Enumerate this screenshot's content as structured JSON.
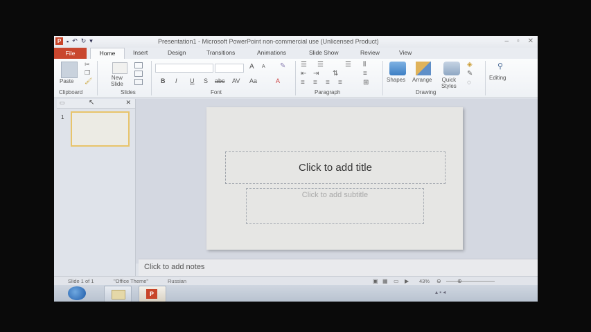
{
  "window": {
    "title": "Presentation1 - Microsoft PowerPoint non-commercial use (Unlicensed Product)",
    "app_icon": "P"
  },
  "tabs": [
    "File",
    "Home",
    "Insert",
    "Design",
    "Transitions",
    "Animations",
    "Slide Show",
    "Review",
    "View"
  ],
  "ribbon": {
    "clipboard": {
      "paste": "Paste",
      "label": "Clipboard"
    },
    "slides": {
      "new_slide_line1": "New",
      "new_slide_line2": "Slide",
      "label": "Slides"
    },
    "font": {
      "label": "Font",
      "bold": "B",
      "italic": "I",
      "underline": "U",
      "strike": "S",
      "shadow": "abc",
      "spacing": "AV",
      "case": "Aa",
      "grow": "A",
      "shrink": "A"
    },
    "paragraph": {
      "label": "Paragraph"
    },
    "drawing": {
      "shapes": "Shapes",
      "arrange": "Arrange",
      "quick1": "Quick",
      "quick2": "Styles",
      "label": "Drawing"
    },
    "editing": {
      "label": "Editing"
    }
  },
  "slides_panel": {
    "slide_number": "1"
  },
  "slide": {
    "title_placeholder": "Click to add title",
    "subtitle_placeholder": "Click to add subtitle"
  },
  "notes": {
    "placeholder": "Click to add notes"
  },
  "status": {
    "slide": "Slide 1 of 1",
    "theme": "\"Office Theme\"",
    "language": "Russian",
    "zoom": "43%"
  }
}
